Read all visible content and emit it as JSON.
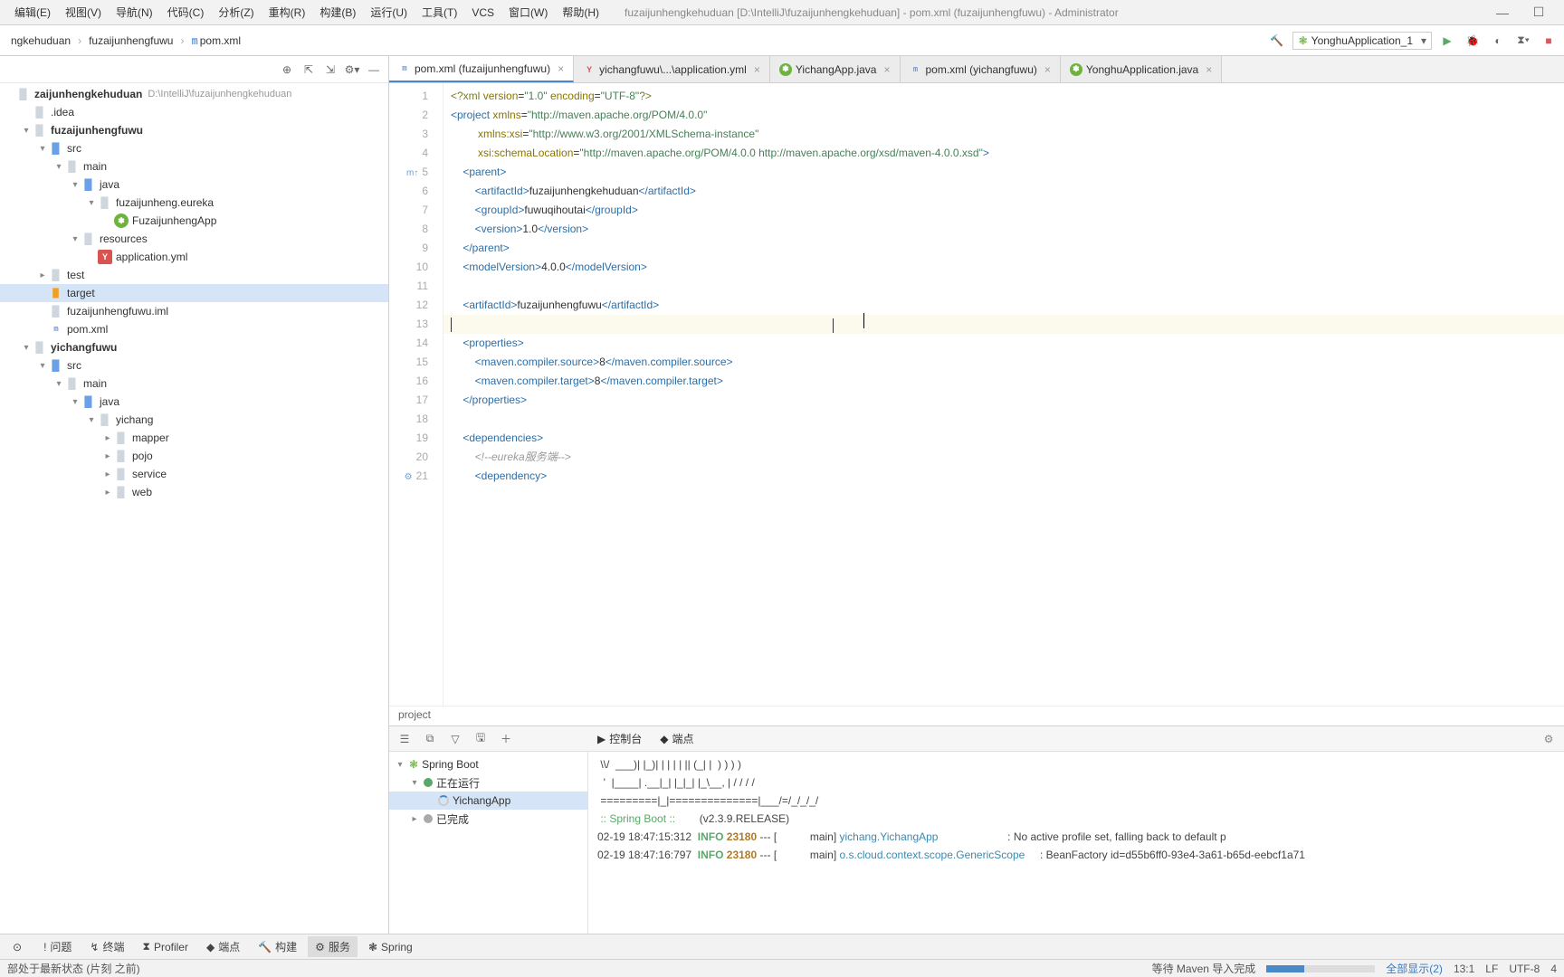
{
  "menu": [
    "编辑(E)",
    "视图(V)",
    "导航(N)",
    "代码(C)",
    "分析(Z)",
    "重构(R)",
    "构建(B)",
    "运行(U)",
    "工具(T)",
    "VCS",
    "窗口(W)",
    "帮助(H)"
  ],
  "window_title": "fuzaijunhengkehuduan [D:\\IntelliJ\\fuzaijunhengkehuduan] - pom.xml (fuzaijunhengfuwu) - Administrator",
  "breadcrumb": [
    "ngkehuduan",
    "fuzaijunhengfuwu",
    "pom.xml"
  ],
  "run_config": "YonghuApplication_1",
  "tabs": [
    {
      "icon": "m",
      "label": "pom.xml (fuzaijunhengfuwu)",
      "active": true
    },
    {
      "icon": "y",
      "label": "yichangfuwu\\...\\application.yml"
    },
    {
      "icon": "s",
      "label": "YichangApp.java"
    },
    {
      "icon": "m",
      "label": "pom.xml (yichangfuwu)"
    },
    {
      "icon": "s",
      "label": "YonghuApplication.java"
    }
  ],
  "project_tree": [
    {
      "d": 0,
      "tw": "",
      "icon": "folder",
      "label": "zaijunhengkehuduan",
      "hint": "D:\\IntelliJ\\fuzaijunhengkehuduan",
      "bold": true
    },
    {
      "d": 1,
      "tw": "",
      "icon": "folder",
      "label": ".idea"
    },
    {
      "d": 1,
      "tw": "▾",
      "icon": "folder",
      "label": "fuzaijunhengfuwu",
      "bold": true
    },
    {
      "d": 2,
      "tw": "▾",
      "icon": "folder-blue",
      "label": "src"
    },
    {
      "d": 3,
      "tw": "▾",
      "icon": "folder",
      "label": "main"
    },
    {
      "d": 4,
      "tw": "▾",
      "icon": "folder-blue",
      "label": "java"
    },
    {
      "d": 5,
      "tw": "▾",
      "icon": "folder",
      "label": "fuzaijunheng.eureka"
    },
    {
      "d": 6,
      "tw": "",
      "icon": "spring",
      "label": "FuzaijunhengApp"
    },
    {
      "d": 4,
      "tw": "▾",
      "icon": "folder",
      "label": "resources"
    },
    {
      "d": 5,
      "tw": "",
      "icon": "yml",
      "label": "application.yml"
    },
    {
      "d": 2,
      "tw": "▸",
      "icon": "folder",
      "label": "test"
    },
    {
      "d": 2,
      "tw": "",
      "icon": "orange",
      "label": "target",
      "sel": true
    },
    {
      "d": 2,
      "tw": "",
      "icon": "folder",
      "label": "fuzaijunhengfuwu.iml"
    },
    {
      "d": 2,
      "tw": "",
      "icon": "m",
      "label": "pom.xml"
    },
    {
      "d": 1,
      "tw": "▾",
      "icon": "folder",
      "label": "yichangfuwu",
      "bold": true
    },
    {
      "d": 2,
      "tw": "▾",
      "icon": "folder-blue",
      "label": "src"
    },
    {
      "d": 3,
      "tw": "▾",
      "icon": "folder",
      "label": "main"
    },
    {
      "d": 4,
      "tw": "▾",
      "icon": "folder-blue",
      "label": "java"
    },
    {
      "d": 5,
      "tw": "▾",
      "icon": "folder",
      "label": "yichang"
    },
    {
      "d": 6,
      "tw": "▸",
      "icon": "folder",
      "label": "mapper"
    },
    {
      "d": 6,
      "tw": "▸",
      "icon": "folder",
      "label": "pojo"
    },
    {
      "d": 6,
      "tw": "▸",
      "icon": "folder",
      "label": "service"
    },
    {
      "d": 6,
      "tw": "▸",
      "icon": "folder",
      "label": "web"
    }
  ],
  "code_lines": [
    {
      "n": 1,
      "html": "<span class='tk-prolog'>&lt;?xml</span> <span class='tk-attr'>version</span>=<span class='tk-str'>\"1.0\"</span> <span class='tk-attr'>encoding</span>=<span class='tk-str'>\"UTF-8\"</span><span class='tk-prolog'>?&gt;</span>"
    },
    {
      "n": 2,
      "html": "<span class='tk-tag'>&lt;project</span> <span class='tk-attr'>xmlns</span>=<span class='tk-str'>\"http://maven.apache.org/POM/4.0.0\"</span>"
    },
    {
      "n": 3,
      "html": "         <span class='tk-attr'>xmlns:xsi</span>=<span class='tk-str'>\"http://www.w3.org/2001/XMLSchema-instance\"</span>"
    },
    {
      "n": 4,
      "html": "         <span class='tk-attr'>xsi:schemaLocation</span>=<span class='tk-str'>\"http://maven.apache.org/POM/4.0.0 http://maven.apache.org/xsd/maven-4.0.0.xsd\"</span><span class='tk-tag'>&gt;</span>"
    },
    {
      "n": 5,
      "html": "    <span class='tk-tag'>&lt;parent&gt;</span>",
      "gm": "m↑"
    },
    {
      "n": 6,
      "html": "        <span class='tk-tag'>&lt;artifactId&gt;</span>fuzaijunhengkehuduan<span class='tk-tag'>&lt;/artifactId&gt;</span>"
    },
    {
      "n": 7,
      "html": "        <span class='tk-tag'>&lt;groupId&gt;</span>fuwuqihoutai<span class='tk-tag'>&lt;/groupId&gt;</span>"
    },
    {
      "n": 8,
      "html": "        <span class='tk-tag'>&lt;version&gt;</span>1.0<span class='tk-tag'>&lt;/version&gt;</span>"
    },
    {
      "n": 9,
      "html": "    <span class='tk-tag'>&lt;/parent&gt;</span>"
    },
    {
      "n": 10,
      "html": "    <span class='tk-tag'>&lt;modelVersion&gt;</span>4.0.0<span class='tk-tag'>&lt;/modelVersion&gt;</span>"
    },
    {
      "n": 11,
      "html": ""
    },
    {
      "n": 12,
      "html": "    <span class='tk-tag'>&lt;artifactId&gt;</span>fuzaijunhengfuwu<span class='tk-tag'>&lt;/artifactId&gt;</span>"
    },
    {
      "n": 13,
      "html": "<span class='cursor'></span>",
      "hl": true
    },
    {
      "n": 14,
      "html": "    <span class='tk-tag'>&lt;properties&gt;</span>"
    },
    {
      "n": 15,
      "html": "        <span class='tk-tag'>&lt;maven.compiler.source&gt;</span>8<span class='tk-tag'>&lt;/maven.compiler.source&gt;</span>"
    },
    {
      "n": 16,
      "html": "        <span class='tk-tag'>&lt;maven.compiler.target&gt;</span>8<span class='tk-tag'>&lt;/maven.compiler.target&gt;</span>"
    },
    {
      "n": 17,
      "html": "    <span class='tk-tag'>&lt;/properties&gt;</span>"
    },
    {
      "n": 18,
      "html": ""
    },
    {
      "n": 19,
      "html": "    <span class='tk-tag'>&lt;dependencies&gt;</span>"
    },
    {
      "n": 20,
      "html": "        <span class='tk-com'>&lt;!--eureka服务端--&gt;</span>"
    },
    {
      "n": 21,
      "html": "        <span class='tk-tag'>&lt;dependency&gt;</span>",
      "gm": "⚙"
    }
  ],
  "caret_marker_col": 58,
  "breadcrumb_bottom": "project",
  "services": {
    "tabs": [
      {
        "icon": "▶",
        "label": "控制台"
      },
      {
        "icon": "◆",
        "label": "端点"
      }
    ],
    "tree": [
      {
        "d": 0,
        "tw": "▾",
        "icon": "spring",
        "label": "Spring Boot"
      },
      {
        "d": 1,
        "tw": "▾",
        "icon": "green",
        "label": "正在运行"
      },
      {
        "d": 2,
        "tw": "",
        "icon": "spinner",
        "label": "YichangApp",
        "bold": true,
        "sel": true
      },
      {
        "d": 1,
        "tw": "▸",
        "icon": "grey",
        "label": "已完成"
      }
    ],
    "console_lines": [
      {
        "plain": " \\\\/  ___)| |_)| | | | | || (_| |  ) ) ) )"
      },
      {
        "plain": "  '  |____| .__|_| |_|_| |_\\__, | / / / /"
      },
      {
        "plain": " =========|_|==============|___/=/_/_/_/"
      },
      {
        "html": " <span class='banner'>:: Spring Boot ::</span>        (v2.3.9.RELEASE)"
      },
      {
        "plain": ""
      },
      {
        "html": "02-19 18:47:15:312  <span class='info'>INFO</span> <span class='pid'>23180</span> --- [           main] <span class='logger'>yichang.YichangApp</span>                       : No active profile set, falling back to default p"
      },
      {
        "html": "02-19 18:47:16:797  <span class='info'>INFO</span> <span class='pid'>23180</span> --- [           main] <span class='logger'>o.s.cloud.context.scope.GenericScope</span>     : BeanFactory id=d55b6ff0-93e4-3a61-b65d-eebcf1a71"
      }
    ]
  },
  "toolstrip": [
    {
      "icon": "⊙",
      "label": ""
    },
    {
      "icon": "!",
      "label": "问题"
    },
    {
      "icon": "↯",
      "label": "终端"
    },
    {
      "icon": "⧗",
      "label": "Profiler"
    },
    {
      "icon": "◆",
      "label": "端点"
    },
    {
      "icon": "🔨",
      "label": "构建"
    },
    {
      "icon": "⚙",
      "label": "服务",
      "active": true
    },
    {
      "icon": "❃",
      "label": "Spring"
    }
  ],
  "status": {
    "left": "部处于最新状态 (片刻 之前)",
    "progress_label": "等待 Maven 导入完成",
    "show_all": "全部显示(2)",
    "pos": "13:1",
    "eol": "LF",
    "enc": "UTF-8",
    "spaces": "4"
  }
}
